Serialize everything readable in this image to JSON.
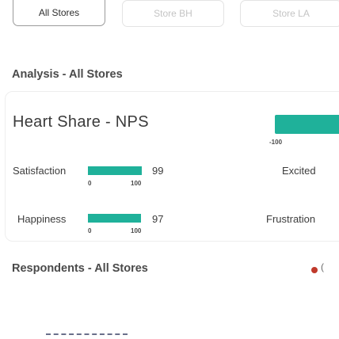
{
  "tabs": [
    {
      "label": "All Stores",
      "active": true
    },
    {
      "label": "Store BH",
      "active": false
    },
    {
      "label": "Store LA",
      "active": false
    }
  ],
  "analysis": {
    "title": "Analysis - All Stores",
    "card_title": "Heart Share - NPS",
    "legend_min": "-100",
    "rows": [
      {
        "label": "Satisfaction",
        "value": "99",
        "min": "0",
        "max": "100",
        "fill": 0.99,
        "right_label": "Excited"
      },
      {
        "label": "Happiness",
        "value": "97",
        "min": "0",
        "max": "100",
        "fill": 0.97,
        "right_label": "Frustration"
      }
    ]
  },
  "respondents": {
    "title": "Respondents - All Stores"
  },
  "colors": {
    "accent": "#1fb19a",
    "legend_dot": "#c0392b"
  }
}
